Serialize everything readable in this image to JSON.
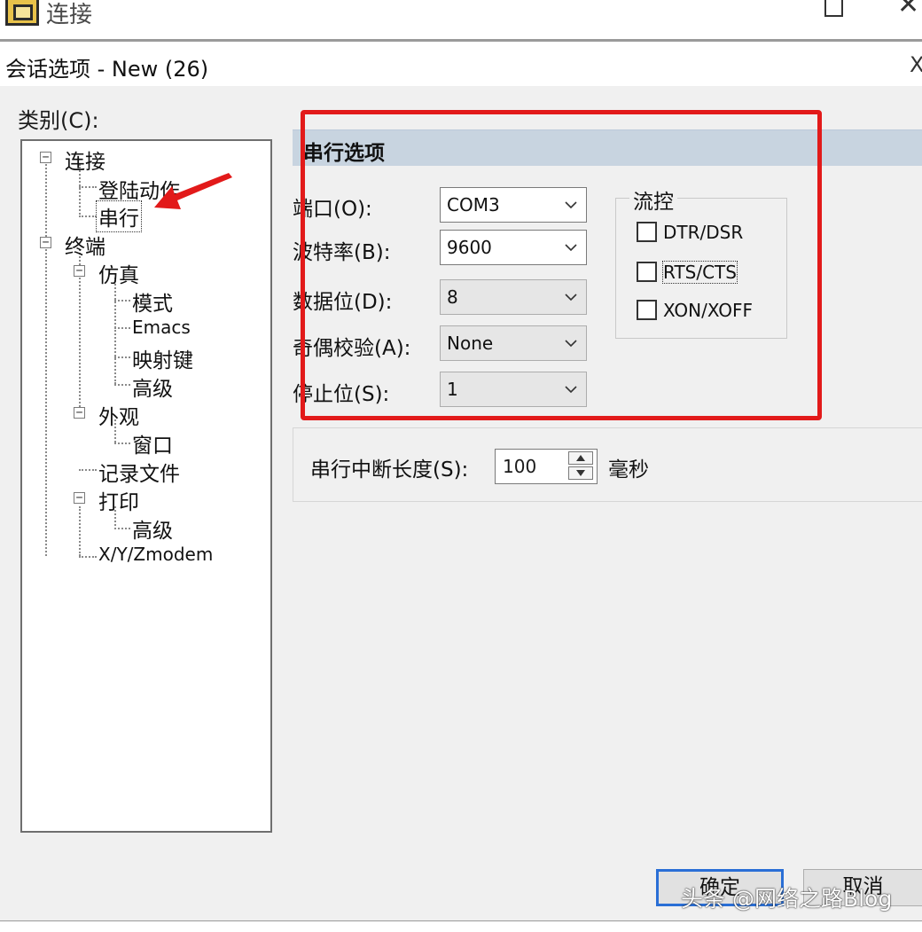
{
  "window": {
    "title": "连接",
    "maximize_icon": "maximize-icon",
    "close_icon": "close-icon"
  },
  "dialog": {
    "title": "会话选项 - New (26)",
    "close_glyph": "X",
    "category_label": "类别(C):"
  },
  "tree": {
    "items": [
      {
        "label": "连接",
        "toggle": "−"
      },
      {
        "label": "登陆动作"
      },
      {
        "label": "串行",
        "selected": true
      },
      {
        "label": "终端",
        "toggle": "−"
      },
      {
        "label": "仿真",
        "toggle": "−"
      },
      {
        "label": "模式"
      },
      {
        "label": "Emacs"
      },
      {
        "label": "映射键"
      },
      {
        "label": "高级"
      },
      {
        "label": "外观",
        "toggle": "−"
      },
      {
        "label": "窗口"
      },
      {
        "label": "记录文件"
      },
      {
        "label": "打印",
        "toggle": "−"
      },
      {
        "label": "高级"
      },
      {
        "label": "X/Y/Zmodem"
      }
    ]
  },
  "serial": {
    "section_title": "串行选项",
    "port": {
      "label": "端口(O):",
      "value": "COM3"
    },
    "baud": {
      "label": "波特率(B):",
      "value": "9600"
    },
    "data_bits": {
      "label": "数据位(D):",
      "value": "8"
    },
    "parity": {
      "label": "奇偶校验(A):",
      "value": "None"
    },
    "stop_bits": {
      "label": "停止位(S):",
      "value": "1"
    },
    "flow_control": {
      "title": "流控",
      "options": [
        {
          "label": "DTR/DSR",
          "checked": false
        },
        {
          "label": "RTS/CTS",
          "checked": false
        },
        {
          "label": "XON/XOFF",
          "checked": false
        }
      ]
    },
    "break_length": {
      "label": "串行中断长度(S):",
      "value": "100",
      "unit": "毫秒"
    }
  },
  "buttons": {
    "ok": "确定",
    "cancel": "取消"
  },
  "watermark": "头条 @网络之路Blog",
  "colors": {
    "highlight_border": "#e21a1a",
    "arrow": "#e21a1a",
    "section_header": "#c8d4e0",
    "ok_border": "#2a6fd6"
  }
}
